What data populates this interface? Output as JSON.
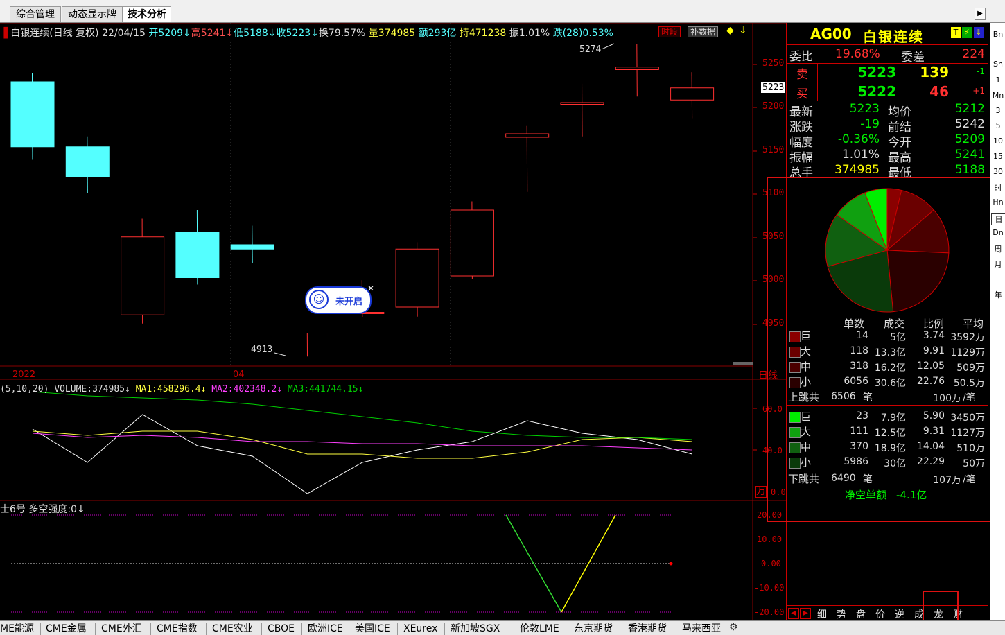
{
  "top_tabs": [
    "综合管理",
    "动态显示牌",
    "技术分析"
  ],
  "chart": {
    "info": {
      "name": "白银连续(日线 复权)",
      "date": "22/04/15",
      "open": "开5209",
      "high": "高5241",
      "low": "低5188",
      "close": "收5223",
      "turnover": "换79.57%",
      "volume": "量374985",
      "amount": "额293亿",
      "hold": "持471238",
      "amplitude": "振1.01%",
      "change": "跌(28)0.53%",
      "btn_timeframe": "时段",
      "btn_fill": "补数据"
    },
    "price_axis": [
      "5250",
      "5200",
      "5150",
      "5100",
      "5050",
      "5000",
      "4950"
    ],
    "current_price_tag": "5223",
    "high_mark": "5274",
    "low_mark": "4913",
    "x_labels": [
      "2022",
      "04"
    ],
    "period_label": "日线",
    "candles": [
      {
        "o": 5230,
        "c": 5155,
        "h": 5240,
        "l": 5140
      },
      {
        "o": 5155,
        "c": 5120,
        "h": 5167,
        "l": 5102
      },
      {
        "o": 4961,
        "c": 5051,
        "h": 5072,
        "l": 4951
      },
      {
        "o": 5056,
        "c": 5004,
        "h": 5082,
        "l": 4996
      },
      {
        "o": 5042,
        "c": 5037,
        "h": 5064,
        "l": 5021
      },
      {
        "o": 4940,
        "c": 4976,
        "h": 4984,
        "l": 4913
      },
      {
        "o": 4963,
        "c": 4964,
        "h": 5001,
        "l": 4958
      },
      {
        "o": 4970,
        "c": 5037,
        "h": 5045,
        "l": 4959
      },
      {
        "o": 5006,
        "c": 5082,
        "h": 5092,
        "l": 5002
      },
      {
        "o": 5166,
        "c": 5170,
        "h": 5179,
        "l": 5103
      },
      {
        "o": 5204,
        "c": 5206,
        "h": 5230,
        "l": 5167
      },
      {
        "o": 5244,
        "c": 5247,
        "h": 5274,
        "l": 5213
      },
      {
        "o": 5209,
        "c": 5223,
        "h": 5241,
        "l": 5188
      }
    ],
    "vol_header": {
      "prefix": "(5,10,20)",
      "volume": "VOLUME:374985",
      "ma1": "MA1:458296.4",
      "ma2": "MA2:402348.2",
      "ma3": "MA3:441744.15"
    },
    "vol_axis": [
      "60.0",
      "40.0",
      "0.0"
    ],
    "vol_unit": "万",
    "vol_series": {
      "volume": [
        50,
        34,
        57,
        42,
        37,
        19,
        34,
        40,
        44,
        54,
        48,
        45,
        38
      ],
      "ma1": [
        49,
        47,
        49,
        49,
        45,
        38,
        38,
        36,
        36,
        39,
        45,
        46,
        44
      ],
      "ma2": [
        48,
        46,
        47,
        46,
        44,
        44,
        43,
        43,
        42,
        42,
        42,
        41,
        40
      ],
      "ma3": [
        68,
        66,
        65,
        64,
        62,
        59,
        56,
        53,
        49,
        47,
        46,
        46,
        45
      ]
    },
    "ind_header": {
      "name": "士6号",
      "label": "多空强度:0"
    },
    "ind_axis": [
      "20.00",
      "10.00",
      "0.00",
      "-10.00",
      "-20.00"
    ],
    "ind_series": [
      20,
      20,
      20,
      20,
      20,
      20,
      20,
      20,
      20,
      20,
      -20,
      20,
      0
    ],
    "popup_label": "未开启"
  },
  "panel": {
    "code": "AG00",
    "name": "白银连续",
    "committee_ratio_label": "委比",
    "committee_ratio": "19.68%",
    "committee_diff_label": "委差",
    "committee_diff": "224",
    "sell_label": "卖",
    "sell_price": "5223",
    "sell_vol": "139",
    "sell_chg": "-1",
    "buy_label": "买",
    "buy_price": "5222",
    "buy_vol": "46",
    "buy_chg": "+1",
    "quotes": [
      {
        "l1": "最新",
        "v1": "5223",
        "l2": "均价",
        "v2": "5212"
      },
      {
        "l1": "涨跌",
        "v1": "-19",
        "l2": "前结",
        "v2": "5242"
      },
      {
        "l1": "幅度",
        "v1": "-0.36%",
        "l2": "今开",
        "v2": "5209"
      },
      {
        "l1": "振幅",
        "v1": "1.01%",
        "l2": "最高",
        "v2": "5241"
      },
      {
        "l1": "总手",
        "v1": "374985",
        "l2": "最低",
        "v2": "5188"
      }
    ],
    "pie": [
      {
        "pct": 3.74,
        "color": "#8a0000"
      },
      {
        "pct": 9.91,
        "color": "#6a0000"
      },
      {
        "pct": 12.05,
        "color": "#4a0000"
      },
      {
        "pct": 22.76,
        "color": "#2a0000"
      },
      {
        "pct": 22.29,
        "color": "#0a3a0a"
      },
      {
        "pct": 14.04,
        "color": "#106010"
      },
      {
        "pct": 9.31,
        "color": "#10a010"
      },
      {
        "pct": 5.9,
        "color": "#00ee00"
      }
    ],
    "table_headers": [
      "单数",
      "成交",
      "比例",
      "平均"
    ],
    "up_rows": [
      {
        "label": "巨",
        "count": "14",
        "amount": "5亿",
        "ratio": "3.74",
        "avg": "3592万",
        "color": "#8a0000"
      },
      {
        "label": "大",
        "count": "118",
        "amount": "13.3亿",
        "ratio": "9.91",
        "avg": "1129万",
        "color": "#6a0000"
      },
      {
        "label": "中",
        "count": "318",
        "amount": "16.2亿",
        "ratio": "12.05",
        "avg": "509万",
        "color": "#4a0000"
      },
      {
        "label": "小",
        "count": "6056",
        "amount": "30.6亿",
        "ratio": "22.76",
        "avg": "50.5万",
        "color": "#2a0000"
      }
    ],
    "up_total": {
      "label": "上跳共",
      "count": "6506",
      "unit": "笔",
      "avg": "100万",
      "avg_unit": "/笔"
    },
    "down_rows": [
      {
        "label": "巨",
        "count": "23",
        "amount": "7.9亿",
        "ratio": "5.90",
        "avg": "3450万",
        "color": "#00ee00"
      },
      {
        "label": "大",
        "count": "111",
        "amount": "12.5亿",
        "ratio": "9.31",
        "avg": "1127万",
        "color": "#10a010"
      },
      {
        "label": "中",
        "count": "370",
        "amount": "18.9亿",
        "ratio": "14.04",
        "avg": "510万",
        "color": "#106010"
      },
      {
        "label": "小",
        "count": "5986",
        "amount": "30亿",
        "ratio": "22.29",
        "avg": "50万",
        "color": "#0a3a0a"
      }
    ],
    "down_total": {
      "label": "下跳共",
      "count": "6490",
      "unit": "笔",
      "avg": "107万",
      "avg_unit": "/笔"
    },
    "net_label": "净空单额",
    "net_value": "-4.1亿",
    "sub_tabs": [
      "细",
      "势",
      "盘",
      "价",
      "逆",
      "成",
      "龙",
      "财"
    ]
  },
  "strip_items": [
    "Bn",
    "Sn",
    "1",
    "Mn",
    "3",
    "5",
    "10",
    "15",
    "30",
    "时",
    "Hn",
    "日",
    "Dn",
    "周",
    "月",
    "年"
  ],
  "bottom_tabs": [
    "ME能源",
    "CME金属",
    "CME外汇",
    "CME指数",
    "CME农业",
    "CBOE",
    "欧洲ICE",
    "美国ICE",
    "XEurex",
    "新加坡SGX",
    "伦敦LME",
    "东京期货",
    "香港期货",
    "马来西亚"
  ],
  "colors": {
    "up": "#ff3030",
    "down": "#54ffff",
    "ma1": "#ffffff",
    "ma2": "#ffff40",
    "ma3": "#ff40ff",
    "ma4": "#00d000",
    "accent": "#ffff00"
  }
}
